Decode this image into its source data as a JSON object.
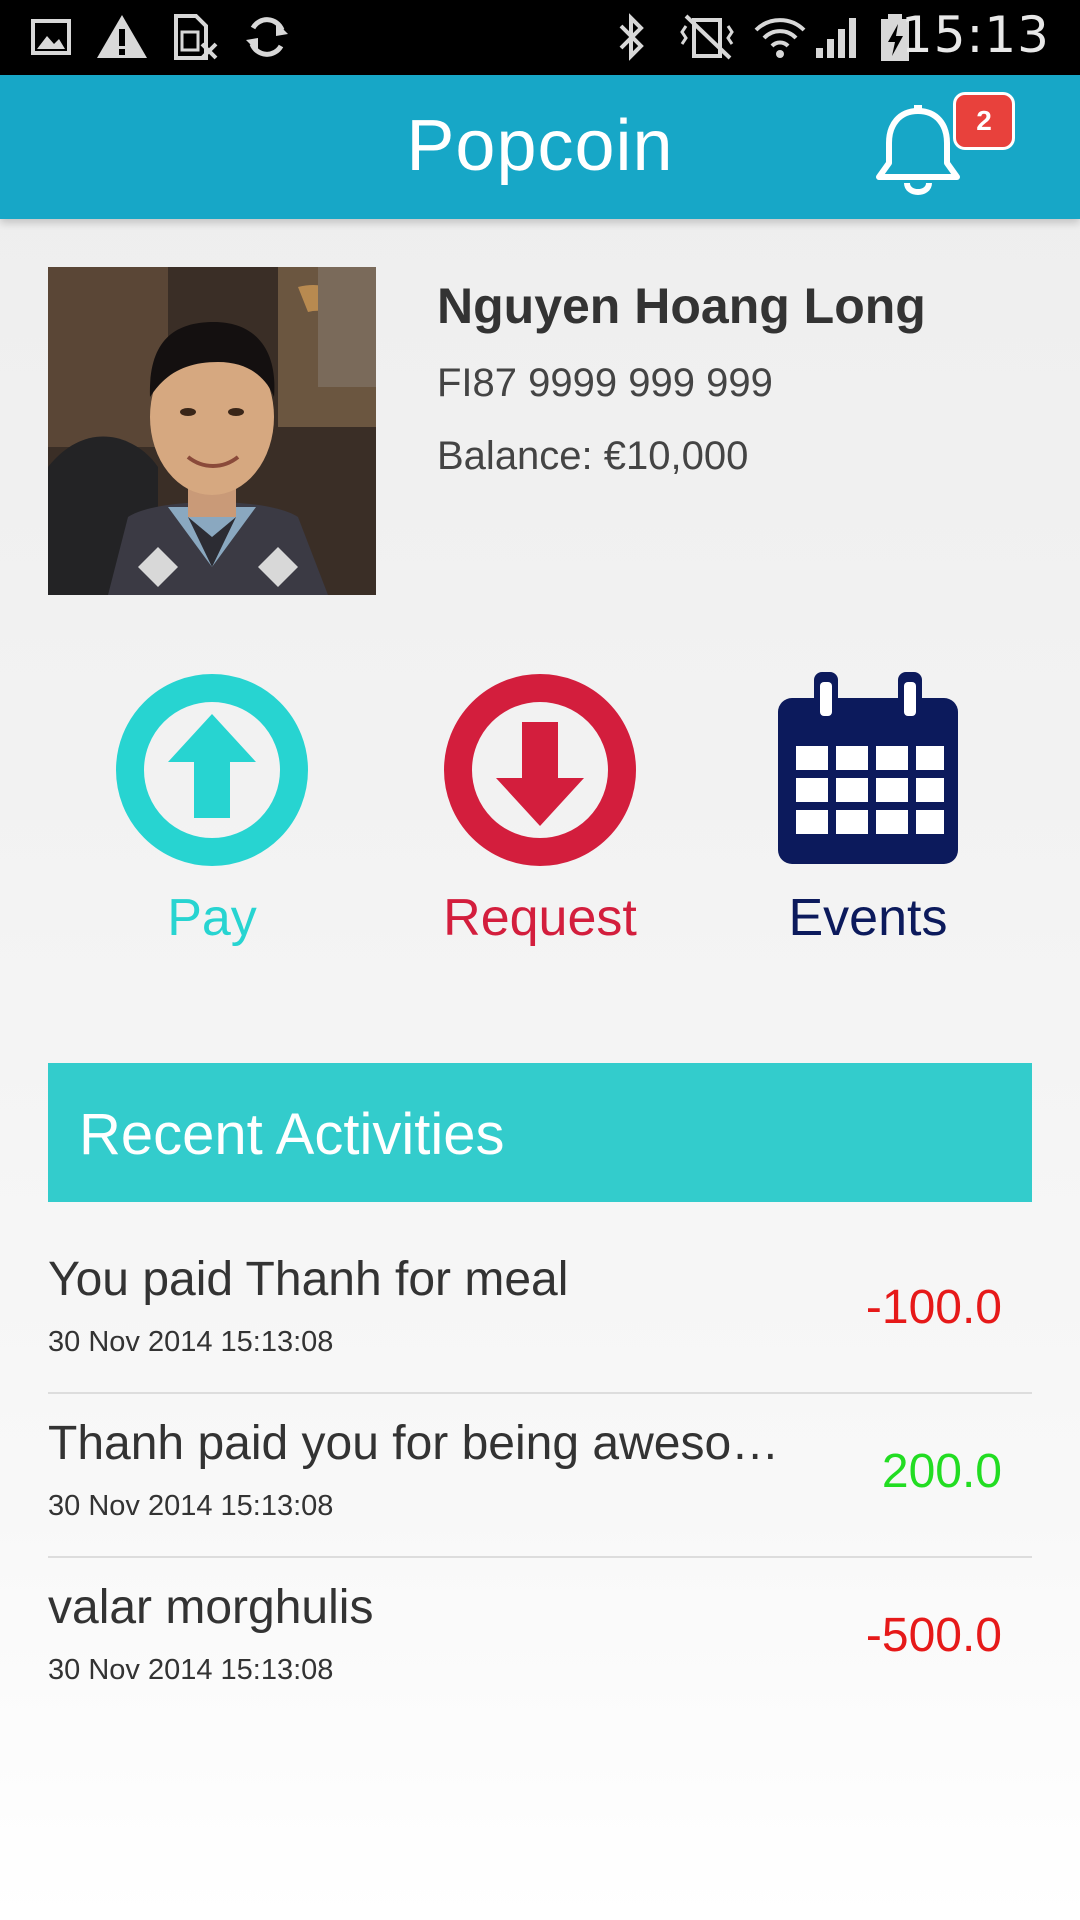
{
  "status_bar": {
    "time": "15:13",
    "icons": [
      "image-icon",
      "warning-icon",
      "sim-missing-icon",
      "sync-icon",
      "bluetooth-icon",
      "vibrate-icon",
      "wifi-icon",
      "signal-icon",
      "battery-charging-icon"
    ]
  },
  "app_bar": {
    "title": "Popcoin",
    "notification_count": "2"
  },
  "profile": {
    "name": "Nguyen Hoang Long",
    "iban": "FI87 9999 999 999",
    "balance": "Balance: €10,000"
  },
  "actions": {
    "pay": "Pay",
    "request": "Request",
    "events": "Events"
  },
  "recent": {
    "title": "Recent Activities",
    "items": [
      {
        "desc": "You paid Thanh for meal",
        "date": "30 Nov 2014 15:13:08",
        "amount": "-100.0",
        "type": "debit"
      },
      {
        "desc": "Thanh paid you for being aweso…",
        "date": "30 Nov 2014 15:13:08",
        "amount": "200.0",
        "type": "credit"
      },
      {
        "desc": "valar morghulis",
        "date": "30 Nov 2014 15:13:08",
        "amount": "-500.0",
        "type": "debit"
      }
    ]
  },
  "colors": {
    "app_bar": "#17a7c7",
    "section_header": "#33cccc",
    "pay": "#27d4d1",
    "request": "#d31e3d",
    "events": "#0c1a5c",
    "debit": "#e61919",
    "credit": "#22dd22"
  }
}
